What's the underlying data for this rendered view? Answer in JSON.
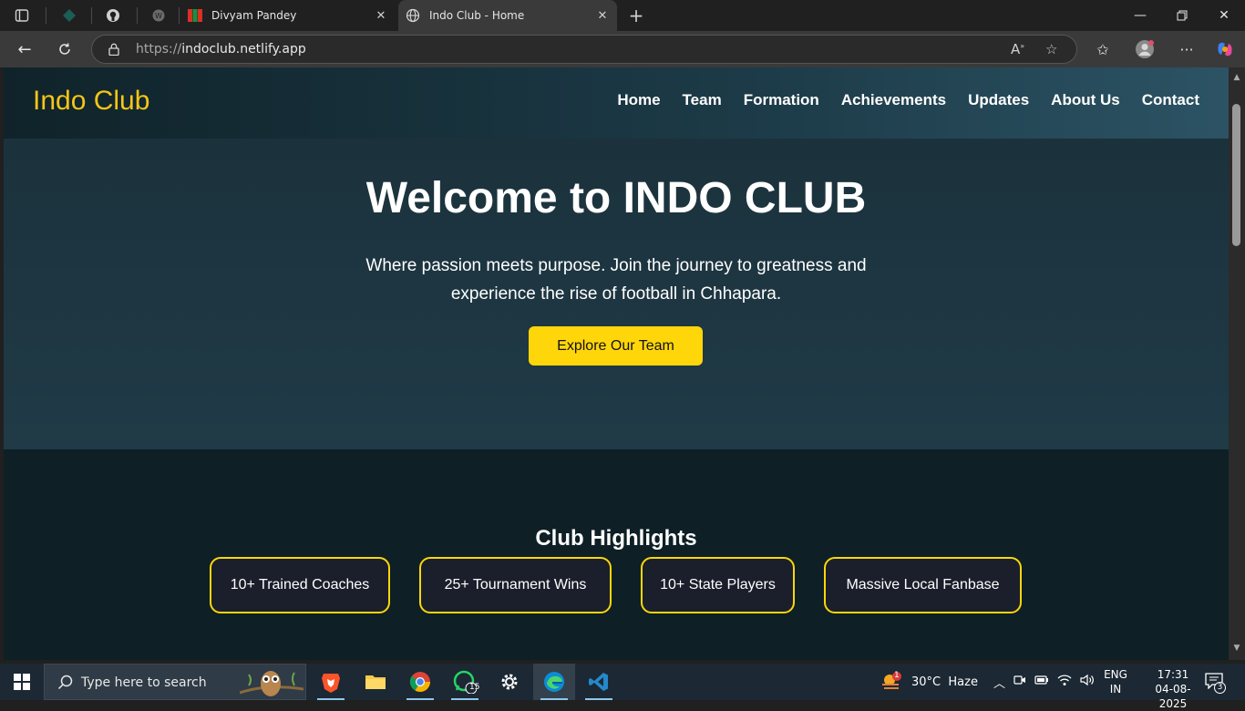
{
  "browser": {
    "tabs": [
      {
        "title": "Divyam Pandey"
      },
      {
        "title": "Indo Club - Home"
      }
    ],
    "url_protocol": "https://",
    "url_host": "indoclub.netlify.app"
  },
  "site": {
    "logo": "Indo Club",
    "nav": [
      "Home",
      "Team",
      "Formation",
      "Achievements",
      "Updates",
      "About Us",
      "Contact"
    ],
    "hero": {
      "title": "Welcome to INDO CLUB",
      "subtitle": "Where passion meets purpose. Join the journey to greatness and experience the rise of football in Chhapara.",
      "button": "Explore Our Team"
    },
    "highlights": {
      "title": "Club Highlights",
      "items": [
        "10+ Trained Coaches",
        "25+ Tournament Wins",
        "10+ State Players",
        "Massive Local Fanbase"
      ]
    }
  },
  "taskbar": {
    "search_placeholder": "Type here to search",
    "whatsapp_badge": "15",
    "weather_badge": "1",
    "weather": "30°C  Haze",
    "lang_top": "ENG",
    "lang_bottom": "IN",
    "time": "17:31",
    "date": "04-08-2025",
    "notification_count": "3"
  },
  "colors": {
    "accent": "#ffd60a",
    "logo": "#f5c518",
    "header_start": "#10232a",
    "header_end": "#2c5364",
    "hero_bg": "#1f3844",
    "section_bg": "#0e1f25"
  }
}
